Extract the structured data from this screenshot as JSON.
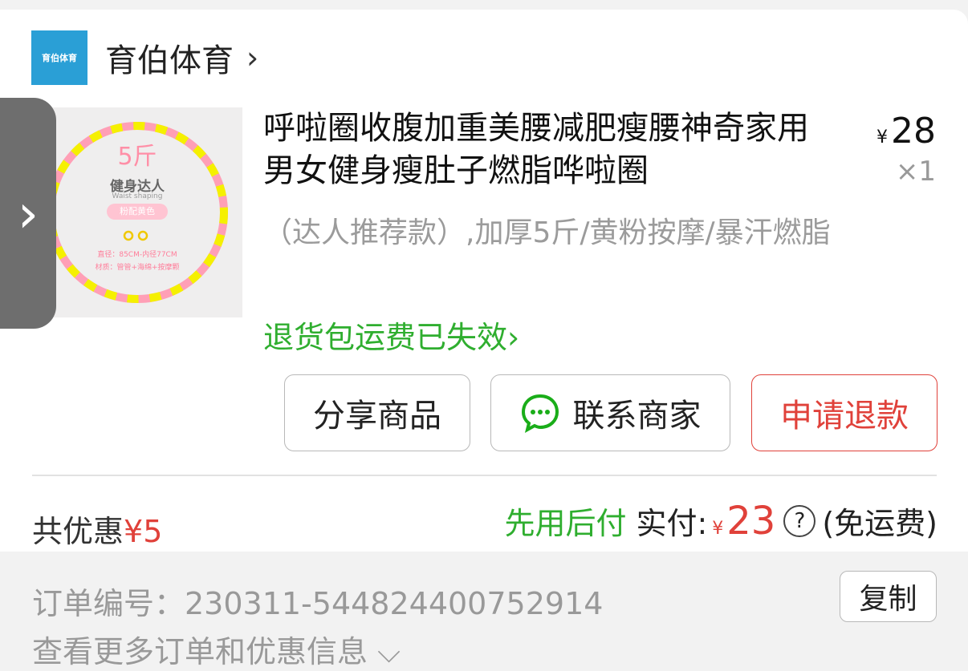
{
  "shop": {
    "logo_text": "育伯体育",
    "name": "育伯体育",
    "arrow": "›"
  },
  "product": {
    "title": "呼啦圈收腹加重美腰减肥瘦腰神奇家用男女健身瘦肚子燃脂哗啦圈",
    "price_symbol": "¥",
    "price": "28",
    "quantity": "×1",
    "spec": "（达人推荐款）,加厚5斤/黄粉按摩/暴汗燃脂",
    "return_notice": "退货包运费已失效›",
    "image": {
      "weight_text": "5斤",
      "brand_text": "健身达人",
      "sub_text": "Waist shaping",
      "color_pill": "粉配黄色",
      "spec_line1": "直径：85CM-内径77CM",
      "spec_line2": "材质：管管+海绵+按摩颗"
    }
  },
  "side_tab": {
    "arrow": "›"
  },
  "actions": {
    "share": "分享商品",
    "contact": "联系商家",
    "refund": "申请退款"
  },
  "summary": {
    "discount_label": "共优惠",
    "discount_value": "¥5",
    "bnpl": "先用后付",
    "paid_label": "实付:",
    "paid_symbol": "¥",
    "paid_amount": "23",
    "help": "?",
    "shipping": "(免运费)"
  },
  "order": {
    "number_text": "订单编号：230311-544824400752914",
    "copy": "复制",
    "more": "查看更多订单和优惠信息 ⌵"
  },
  "colors": {
    "accent_red": "#e0413a",
    "accent_green": "#2fae2f",
    "logo_blue": "#2a9fd6"
  }
}
